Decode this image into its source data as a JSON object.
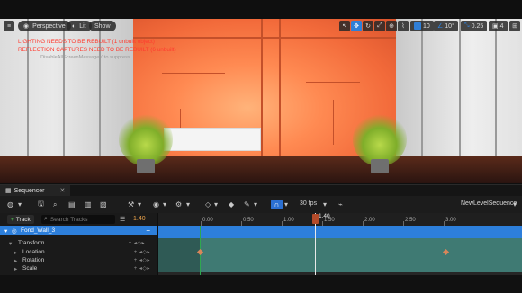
{
  "viewport": {
    "menu_label": "Perspective",
    "view_mode_label": "Lit",
    "show_label": "Show",
    "grid_value": "10",
    "angle_value": "10°",
    "scale_value": "0.25",
    "camera_speed": "4",
    "messages": [
      "LIGHTING NEEDS TO BE REBUILT (1 unbuilt object)",
      "REFLECTION CAPTURES NEED TO BE REBUILT (6 unbuilt)"
    ],
    "message_note": "'DisableAllScreenMessages' to suppress",
    "message_color": "#ff3b2f"
  },
  "sequencer": {
    "tab_label": "Sequencer",
    "fps_label": "30 fps",
    "sequence_name": "NewLevelSequence",
    "add_track_label": "Track",
    "search_placeholder": "Search Tracks",
    "current_time": "1.40",
    "playhead_label": "1.40",
    "tracks": [
      {
        "label": "Fond_Wall_3",
        "level": 0,
        "selected": true
      },
      {
        "label": "Transform",
        "level": 1,
        "selected": false
      },
      {
        "label": "Location",
        "level": 2,
        "selected": false
      },
      {
        "label": "Rotation",
        "level": 2,
        "selected": false
      },
      {
        "label": "Scale",
        "level": 2,
        "selected": false
      }
    ],
    "ruler_labels": [
      "0.00",
      "0.50",
      "1.00",
      "1.50",
      "2.00",
      "2.50",
      "3.00"
    ],
    "accent_color": "#2d7fdb",
    "track_color": "#3f7a73"
  }
}
